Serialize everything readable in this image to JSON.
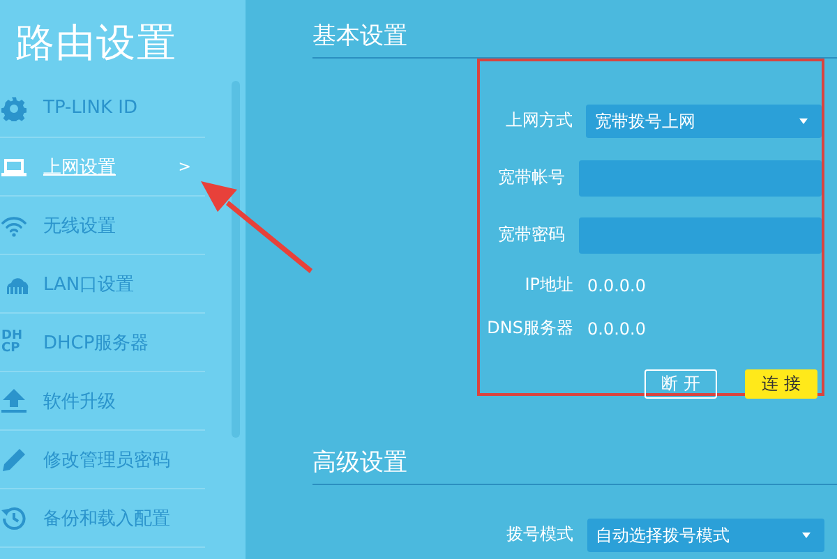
{
  "sidebar": {
    "title": "路由设置",
    "items": [
      {
        "label": "TP-LINK ID",
        "selected": false
      },
      {
        "label": "上网设置",
        "selected": true,
        "indicator": ">"
      },
      {
        "label": "无线设置",
        "selected": false
      },
      {
        "label": "LAN口设置",
        "selected": false
      },
      {
        "label": "DHCP服务器",
        "selected": false,
        "icon_text": [
          "DH",
          "CP"
        ]
      },
      {
        "label": "软件升级",
        "selected": false
      },
      {
        "label": "修改管理员密码",
        "selected": false
      },
      {
        "label": "备份和载入配置",
        "selected": false
      }
    ]
  },
  "basic": {
    "title": "基本设置",
    "fields": [
      {
        "label": "上网方式",
        "kind": "select",
        "value": "宽带拨号上网"
      },
      {
        "label": "宽带帐号",
        "kind": "input"
      },
      {
        "label": "宽带密码",
        "kind": "input"
      },
      {
        "label": "IP地址",
        "kind": "text",
        "value": "0.0.0.0"
      },
      {
        "label": "DNS服务器",
        "kind": "text",
        "value": "0.0.0.0"
      }
    ],
    "buttons": [
      {
        "label": "断开",
        "kind": "outline"
      },
      {
        "label": "连接",
        "kind": "primary"
      }
    ]
  },
  "advanced": {
    "title": "高级设置",
    "fields": [
      {
        "label": "拨号模式",
        "kind": "select",
        "value": "自动选择拨号模式"
      }
    ]
  }
}
